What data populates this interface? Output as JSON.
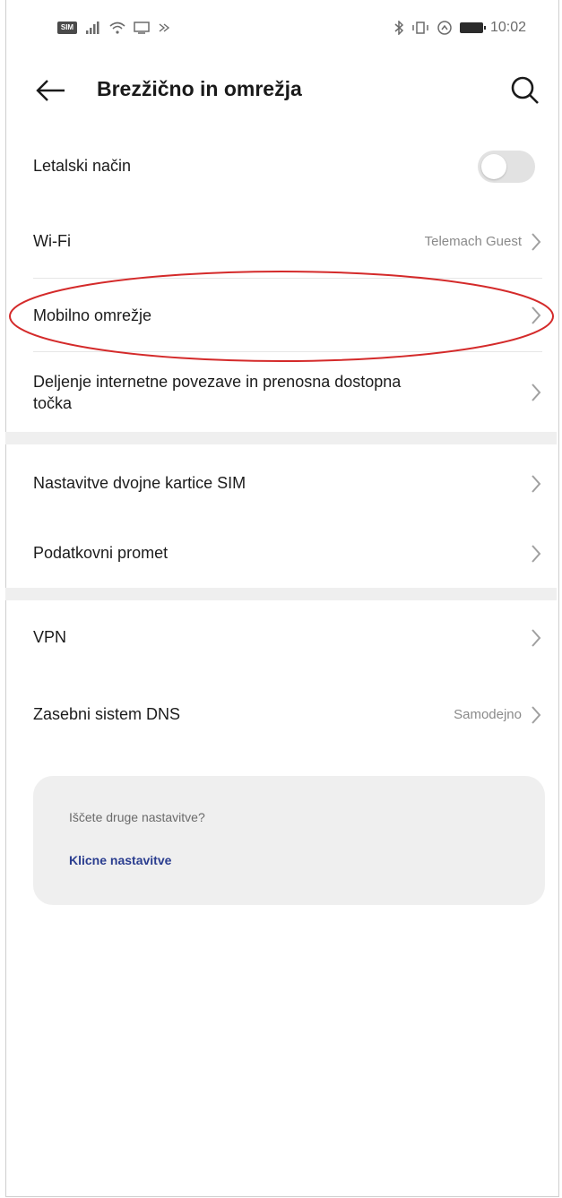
{
  "status_bar": {
    "time": "10:02"
  },
  "header": {
    "title": "Brezžično in omrežja"
  },
  "rows": [
    {
      "label": "Letalski način",
      "value": ""
    },
    {
      "label": "Wi-Fi",
      "value": "Telemach Guest"
    },
    {
      "label": "Mobilno omrežje",
      "value": ""
    },
    {
      "label": "Deljenje internetne povezave in prenosna dostopna",
      "label2": "točka",
      "value": ""
    },
    {
      "label": "Nastavitve dvojne kartice SIM",
      "value": ""
    },
    {
      "label": "Podatkovni promet",
      "value": ""
    },
    {
      "label": "VPN",
      "value": ""
    },
    {
      "label": "Zasebni sistem DNS",
      "value": "Samodejno"
    }
  ],
  "toggle": {
    "airplane_mode_on": false
  },
  "help_card": {
    "question": "Iščete druge nastavitve?",
    "link": "Klicne nastavitve"
  },
  "highlight_color": "#d42a2a",
  "link_color": "#2a3d8f"
}
